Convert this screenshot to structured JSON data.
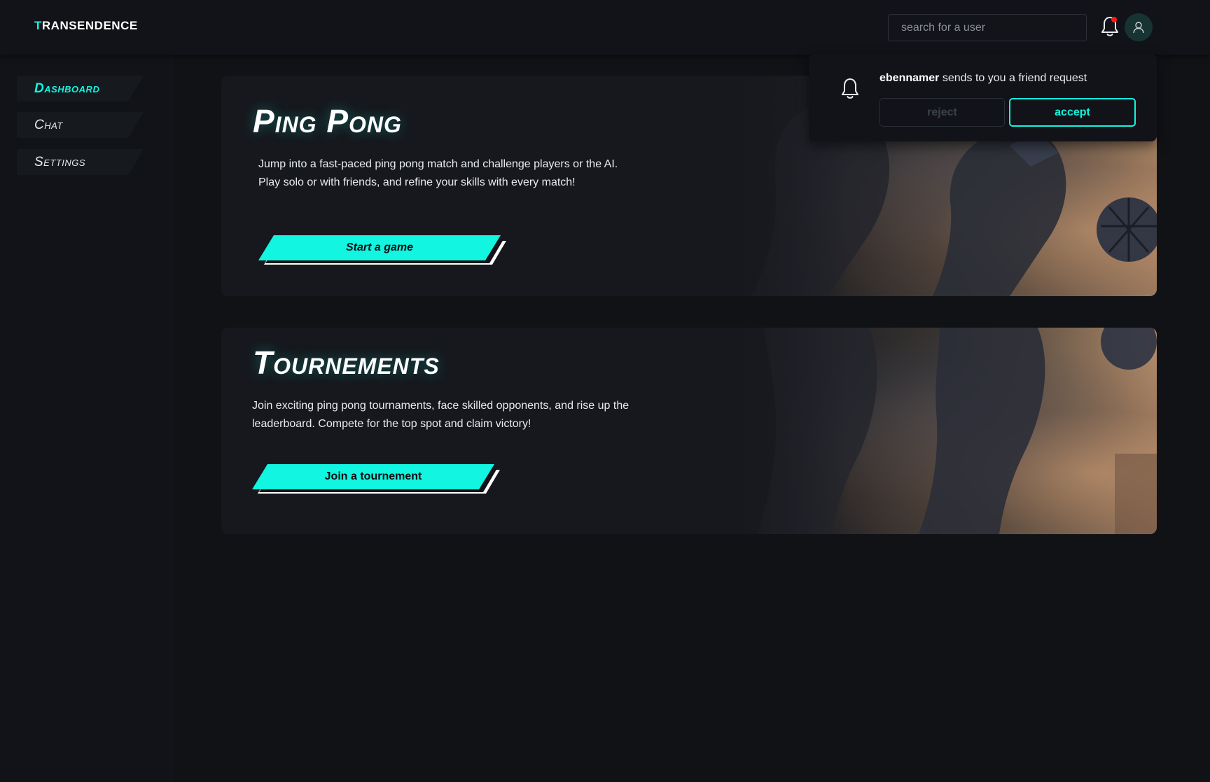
{
  "colors": {
    "accent": "#12f5e0",
    "background": "#101216",
    "notification_dot": "#ff1a1a"
  },
  "header": {
    "logo_first": "T",
    "logo_rest": "RANSENDENCE",
    "search_placeholder": "search for a user",
    "bell_icon": "bell-icon",
    "avatar_icon": "user-icon"
  },
  "sidebar": {
    "items": [
      {
        "label": "Dashboard",
        "active": true
      },
      {
        "label": "Chat",
        "active": false
      },
      {
        "label": "Settings",
        "active": false
      }
    ]
  },
  "cards": [
    {
      "title": "Ping Pong",
      "description": "Jump into a fast-paced ping pong match and challenge players or the AI. Play solo or with friends, and refine your skills with every match!",
      "button": "Start a game"
    },
    {
      "title": "Tournements",
      "description": "Join exciting ping pong tournaments, face skilled opponents, and rise up the leaderboard. Compete for the top spot and claim victory!",
      "button": "Join a tournement"
    }
  ],
  "notification": {
    "username": "ebennamer",
    "message": " sends to you a friend request",
    "reject_label": "reject",
    "accept_label": "accept"
  }
}
